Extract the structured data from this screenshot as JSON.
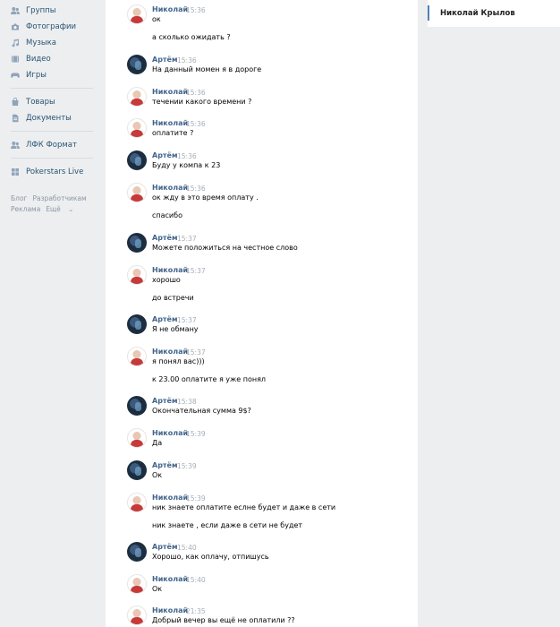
{
  "leftnav": {
    "items": [
      {
        "label": "Группы",
        "icon": "groups-icon"
      },
      {
        "label": "Фотографии",
        "icon": "photos-icon"
      },
      {
        "label": "Музыка",
        "icon": "music-icon"
      },
      {
        "label": "Видео",
        "icon": "video-icon"
      },
      {
        "label": "Игры",
        "icon": "games-icon"
      },
      {
        "label": "Товары",
        "icon": "goods-icon"
      },
      {
        "label": "Документы",
        "icon": "documents-icon"
      },
      {
        "label": "ЛФК Формат",
        "icon": "community-icon"
      },
      {
        "label": "Pokerstars Live",
        "icon": "app-icon"
      }
    ],
    "footer": {
      "blog": "Блог",
      "developers": "Разработчикам",
      "ads": "Реклама",
      "more": "Ещё"
    }
  },
  "chat": {
    "messages": [
      {
        "author": "Николай",
        "time": "15:36",
        "lines": [
          "ок",
          "а сколько ожидать ?"
        ]
      },
      {
        "author": "Артём",
        "time": "15:36",
        "lines": [
          "На данный момен я в дороге"
        ]
      },
      {
        "author": "Николай",
        "time": "15:36",
        "lines": [
          "течении какого времени ?"
        ]
      },
      {
        "author": "Николай",
        "time": "15:36",
        "lines": [
          "оплатите ?"
        ]
      },
      {
        "author": "Артём",
        "time": "15:36",
        "lines": [
          "Буду у компа к 23"
        ]
      },
      {
        "author": "Николай",
        "time": "15:36",
        "lines": [
          "ок жду в это время оплату .",
          "спасибо"
        ]
      },
      {
        "author": "Артём",
        "time": "15:37",
        "lines": [
          "Можете положиться на честное слово"
        ]
      },
      {
        "author": "Николай",
        "time": "15:37",
        "lines": [
          "хорошо",
          "до встречи"
        ]
      },
      {
        "author": "Артём",
        "time": "15:37",
        "lines": [
          "Я не обману"
        ]
      },
      {
        "author": "Николай",
        "time": "15:37",
        "lines": [
          "я понял вас)))",
          "к 23.00 оплатите я уже понял"
        ]
      },
      {
        "author": "Артём",
        "time": "15:38",
        "lines": [
          "Окончательная сумма 9$?"
        ]
      },
      {
        "author": "Николай",
        "time": "15:39",
        "lines": [
          "Да"
        ]
      },
      {
        "author": "Артём",
        "time": "15:39",
        "lines": [
          "Ок"
        ]
      },
      {
        "author": "Николай",
        "time": "15:39",
        "lines": [
          "ник знаете оплатите еслне будет и даже в сети",
          "ник знаете , если даже в сети не будет"
        ]
      },
      {
        "author": "Артём",
        "time": "15:40",
        "lines": [
          "Хорошо, как оплачу, отпишусь"
        ]
      },
      {
        "author": "Николай",
        "time": "15:40",
        "lines": [
          "Ок"
        ]
      },
      {
        "author": "Николай",
        "time": "21:35",
        "lines": [
          "Добрый вечер вы ещё не оплатили ??"
        ]
      }
    ]
  },
  "right": {
    "peer_name": "Николай Крылов"
  }
}
